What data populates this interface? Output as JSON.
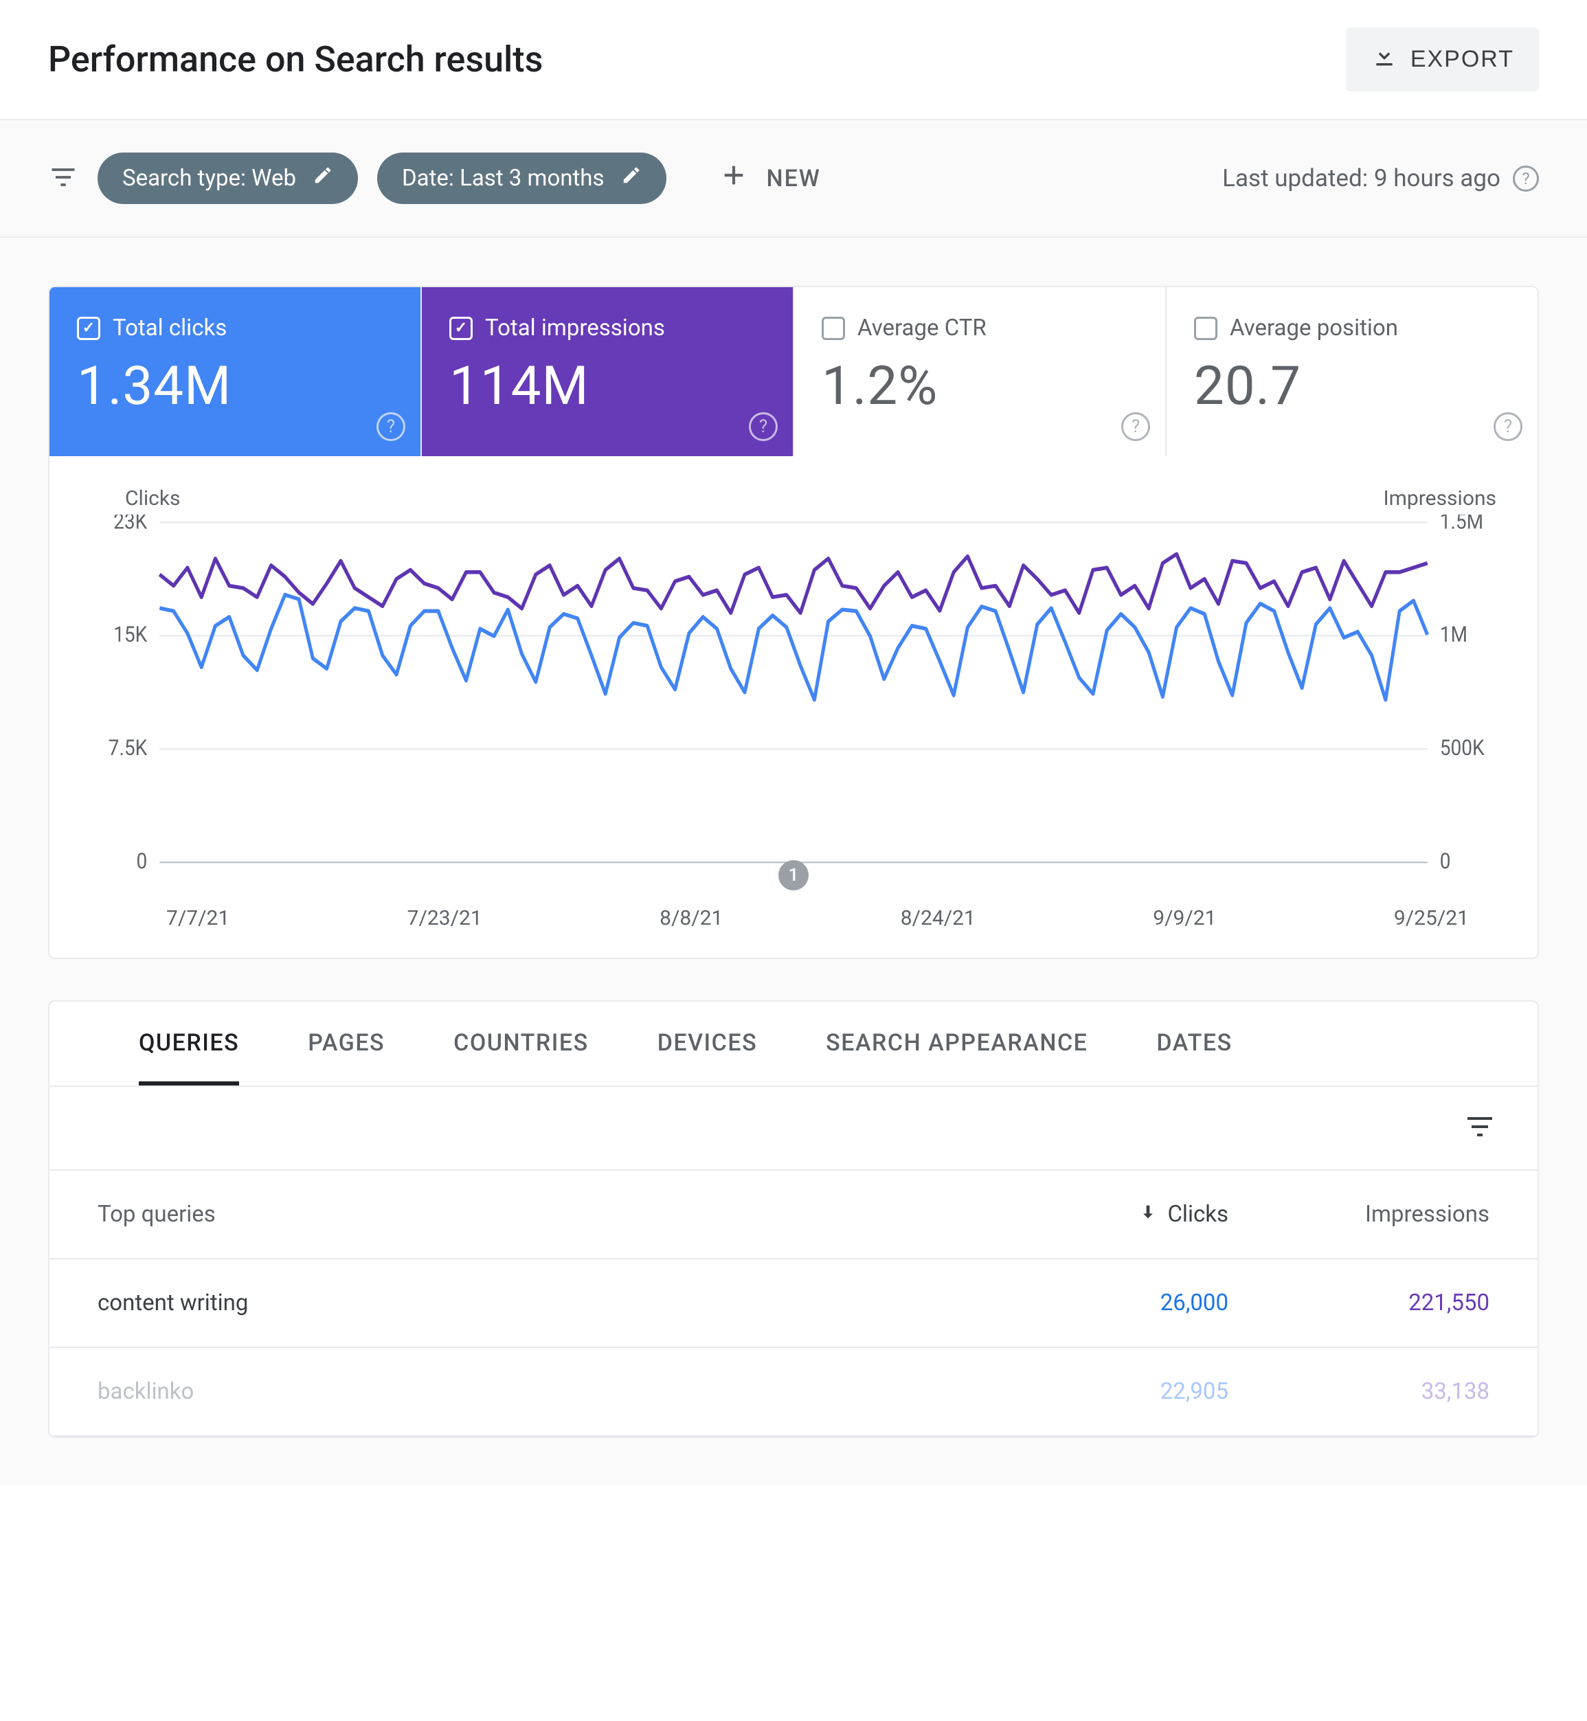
{
  "header": {
    "title": "Performance on Search results",
    "export_label": "EXPORT"
  },
  "filters": {
    "search_type_label": "Search type: Web",
    "date_label": "Date: Last 3 months",
    "new_label": "NEW",
    "last_updated": "Last updated: 9 hours ago"
  },
  "metrics": [
    {
      "label": "Total clicks",
      "value": "1.34M",
      "active": true,
      "color": "blue"
    },
    {
      "label": "Total impressions",
      "value": "114M",
      "active": true,
      "color": "purple"
    },
    {
      "label": "Average CTR",
      "value": "1.2%",
      "active": false,
      "color": "off"
    },
    {
      "label": "Average position",
      "value": "20.7",
      "active": false,
      "color": "off"
    }
  ],
  "chart_axes": {
    "left_title": "Clicks",
    "right_title": "Impressions",
    "left_ticks": [
      "23K",
      "15K",
      "7.5K",
      "0"
    ],
    "right_ticks": [
      "1.5M",
      "1M",
      "500K",
      "0"
    ],
    "x_ticks": [
      "7/7/21",
      "7/23/21",
      "8/8/21",
      "8/24/21",
      "9/9/21",
      "9/25/21"
    ],
    "annotation_number": "1"
  },
  "chart_data": {
    "type": "line",
    "xlabel": "",
    "ylabel_left": "Clicks",
    "ylabel_right": "Impressions",
    "ylim_left": [
      0,
      23000
    ],
    "ylim_right": [
      0,
      1500000
    ],
    "x_categories": [
      "7/7/21",
      "7/23/21",
      "8/8/21",
      "8/24/21",
      "9/9/21",
      "9/25/21"
    ],
    "series": [
      {
        "name": "Clicks",
        "axis": "left",
        "color": "#4285f4",
        "values": [
          17200,
          17000,
          15500,
          13200,
          16000,
          16600,
          14000,
          13000,
          15800,
          18100,
          17800,
          13800,
          13100,
          16300,
          17200,
          17000,
          14000,
          12700,
          16000,
          17000,
          17000,
          14500,
          12300,
          15800,
          15300,
          17100,
          14100,
          12200,
          15900,
          16800,
          16500,
          14000,
          11400,
          15200,
          16200,
          16000,
          13200,
          11700,
          15500,
          16600,
          15800,
          13100,
          11500,
          15800,
          16700,
          15900,
          13300,
          11000,
          16300,
          17100,
          17000,
          15300,
          12400,
          14500,
          16000,
          15800,
          13600,
          11300,
          15900,
          17300,
          17000,
          14300,
          11500,
          16100,
          17200,
          14900,
          12500,
          11400,
          15700,
          16800,
          15900,
          14200,
          11200,
          15900,
          17200,
          16800,
          13600,
          11300,
          16200,
          17500,
          17000,
          14200,
          11800,
          16100,
          17200,
          15200,
          15600,
          14000,
          11000,
          17000,
          17700,
          15400
        ]
      },
      {
        "name": "Impressions",
        "axis": "right",
        "color": "#5e35b1",
        "values": [
          1270000,
          1220000,
          1300000,
          1170000,
          1340000,
          1220000,
          1210000,
          1170000,
          1310000,
          1260000,
          1190000,
          1140000,
          1230000,
          1330000,
          1210000,
          1170000,
          1130000,
          1250000,
          1290000,
          1230000,
          1210000,
          1160000,
          1280000,
          1280000,
          1190000,
          1170000,
          1120000,
          1270000,
          1310000,
          1180000,
          1220000,
          1130000,
          1290000,
          1340000,
          1210000,
          1200000,
          1120000,
          1240000,
          1260000,
          1180000,
          1200000,
          1100000,
          1270000,
          1300000,
          1170000,
          1180000,
          1100000,
          1290000,
          1340000,
          1220000,
          1210000,
          1120000,
          1220000,
          1280000,
          1170000,
          1200000,
          1110000,
          1280000,
          1350000,
          1210000,
          1220000,
          1130000,
          1310000,
          1250000,
          1180000,
          1200000,
          1100000,
          1290000,
          1300000,
          1180000,
          1220000,
          1120000,
          1320000,
          1360000,
          1210000,
          1250000,
          1140000,
          1330000,
          1320000,
          1210000,
          1240000,
          1130000,
          1280000,
          1300000,
          1160000,
          1330000,
          1230000,
          1130000,
          1280000,
          1280000,
          1300000,
          1320000
        ]
      }
    ]
  },
  "tabs": [
    "QUERIES",
    "PAGES",
    "COUNTRIES",
    "DEVICES",
    "SEARCH APPEARANCE",
    "DATES"
  ],
  "active_tab_index": 0,
  "table": {
    "header_query": "Top queries",
    "header_clicks": "Clicks",
    "header_impressions": "Impressions",
    "rows": [
      {
        "query": "content writing",
        "clicks": "26,000",
        "impressions": "221,550",
        "faded": false
      },
      {
        "query": "backlinko",
        "clicks": "22,905",
        "impressions": "33,138",
        "faded": true
      }
    ]
  }
}
